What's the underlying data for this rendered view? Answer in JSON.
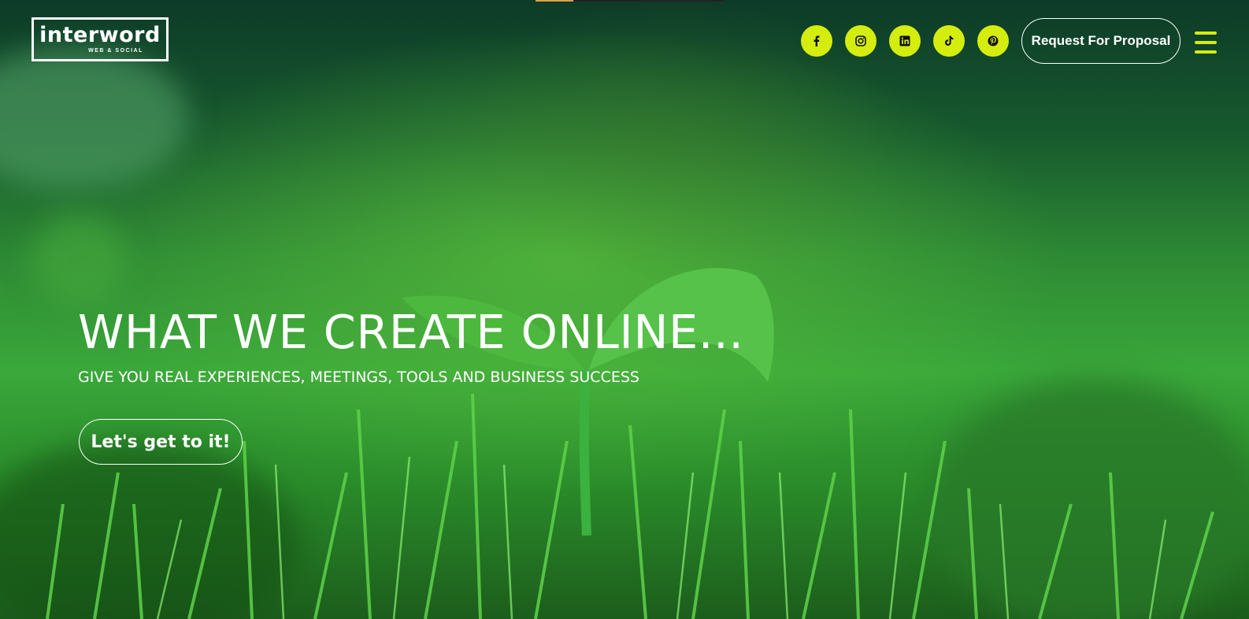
{
  "colors": {
    "accent": "#d4ed0f",
    "text": "#ffffff",
    "progress": "#e0a044"
  },
  "loader": {
    "progress": 0.2
  },
  "header": {
    "logo": {
      "name": "interword",
      "tagline": "WEB & SOCIAL"
    },
    "social": [
      {
        "name": "Facebook",
        "icon": "facebook-icon"
      },
      {
        "name": "Instagram",
        "icon": "instagram-icon"
      },
      {
        "name": "LinkedIn",
        "icon": "linkedin-icon"
      },
      {
        "name": "TikTok",
        "icon": "tiktok-icon"
      },
      {
        "name": "Pinterest",
        "icon": "pinterest-icon"
      }
    ],
    "cta_label": "Request For Proposal",
    "menu_icon": "hamburger-menu-icon"
  },
  "hero": {
    "title": "WHAT WE CREATE ONLINE...",
    "subtitle": "GIVE YOU REAL EXPERIENCES, MEETINGS, TOOLS AND BUSINESS SUCCESS",
    "button_label": "Let's get to it!",
    "background": "grass-sprout-photo"
  }
}
